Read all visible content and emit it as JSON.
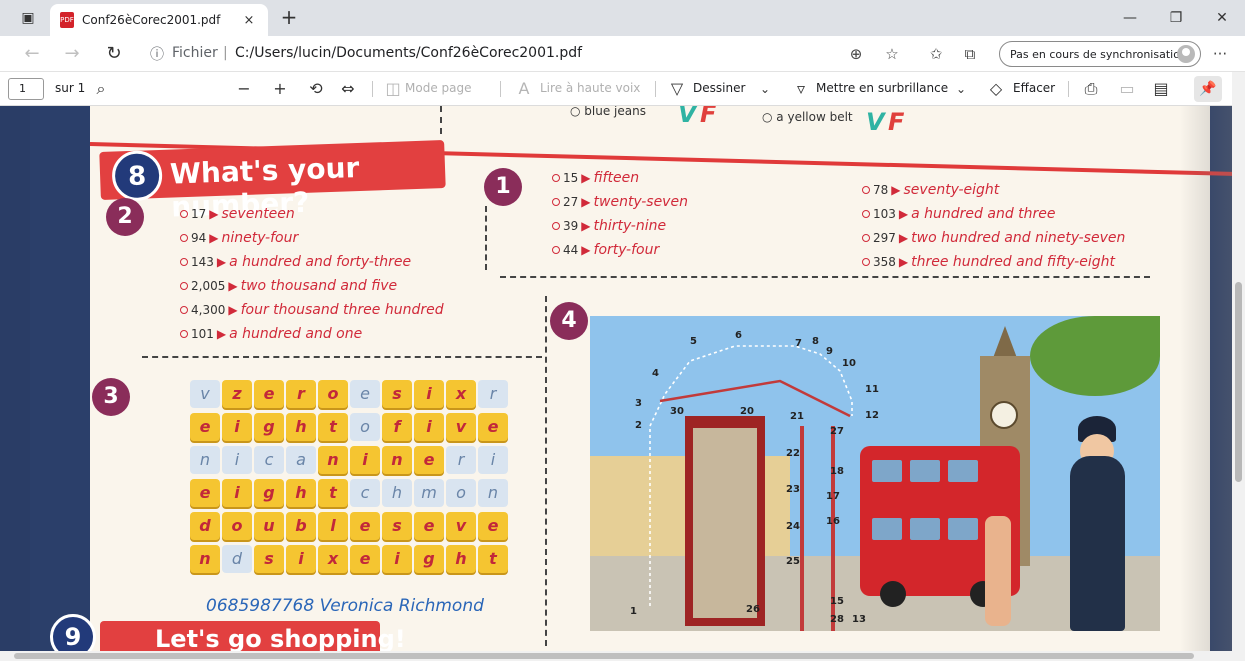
{
  "browser": {
    "tab_title": "Conf26èCorec2001.pdf",
    "tab_close": "×",
    "new_tab": "+",
    "address_scheme": "Fichier",
    "address_url": "C:/Users/lucin/Documents/Conf26èCorec2001.pdf",
    "sync_label": "Pas en cours de synchronisation",
    "more_label": "···"
  },
  "pdf_toolbar": {
    "page_current": "1",
    "page_total": "sur 1",
    "mode_page": "Mode page",
    "read_aloud": "Lire à haute voix",
    "draw": "Dessiner",
    "highlight": "Mettre en surbrillance",
    "erase": "Effacer"
  },
  "document": {
    "top_fragment": {
      "item_left": "blue jeans",
      "item_right": "a yellow belt",
      "v_label": "V",
      "f_label": "F"
    },
    "section8": {
      "number": "8",
      "title": "What's your number?"
    },
    "exercise1": {
      "badge": "1",
      "left": [
        {
          "n": "15",
          "w": "fifteen"
        },
        {
          "n": "27",
          "w": "twenty-seven"
        },
        {
          "n": "39",
          "w": "thirty-nine"
        },
        {
          "n": "44",
          "w": "forty-four"
        }
      ],
      "right": [
        {
          "n": "78",
          "w": "seventy-eight"
        },
        {
          "n": "103",
          "w": "a hundred and three"
        },
        {
          "n": "297",
          "w": "two hundred and ninety-seven"
        },
        {
          "n": "358",
          "w": "three hundred and fifty-eight"
        }
      ]
    },
    "exercise2": {
      "badge": "2",
      "items": [
        {
          "n": "17",
          "w": "seventeen"
        },
        {
          "n": "94",
          "w": "ninety-four"
        },
        {
          "n": "143",
          "w": "a hundred and forty-three"
        },
        {
          "n": "2,005",
          "w": "two thousand and five"
        },
        {
          "n": "4,300",
          "w": "four thousand three hundred"
        },
        {
          "n": "101",
          "w": "a hundred and one"
        }
      ]
    },
    "exercise3": {
      "badge": "3",
      "rows": [
        [
          [
            "v",
            "b"
          ],
          [
            "z",
            "y"
          ],
          [
            "e",
            "y"
          ],
          [
            "r",
            "y"
          ],
          [
            "o",
            "y"
          ],
          [
            "e",
            "b"
          ],
          [
            "s",
            "y"
          ],
          [
            "i",
            "y"
          ],
          [
            "x",
            "y"
          ],
          [
            "r",
            "b"
          ]
        ],
        [
          [
            "e",
            "y"
          ],
          [
            "i",
            "y"
          ],
          [
            "g",
            "y"
          ],
          [
            "h",
            "y"
          ],
          [
            "t",
            "y"
          ],
          [
            "o",
            "b"
          ],
          [
            "f",
            "y"
          ],
          [
            "i",
            "y"
          ],
          [
            "v",
            "y"
          ],
          [
            "e",
            "y"
          ]
        ],
        [
          [
            "n",
            "b"
          ],
          [
            "i",
            "b"
          ],
          [
            "c",
            "b"
          ],
          [
            "a",
            "b"
          ],
          [
            "n",
            "y"
          ],
          [
            "i",
            "y"
          ],
          [
            "n",
            "y"
          ],
          [
            "e",
            "y"
          ],
          [
            "r",
            "b"
          ],
          [
            "i",
            "b"
          ]
        ],
        [
          [
            "e",
            "y"
          ],
          [
            "i",
            "y"
          ],
          [
            "g",
            "y"
          ],
          [
            "h",
            "y"
          ],
          [
            "t",
            "y"
          ],
          [
            "c",
            "b"
          ],
          [
            "h",
            "b"
          ],
          [
            "m",
            "b"
          ],
          [
            "o",
            "b"
          ],
          [
            "n",
            "b"
          ]
        ],
        [
          [
            "d",
            "y"
          ],
          [
            "o",
            "y"
          ],
          [
            "u",
            "y"
          ],
          [
            "b",
            "y"
          ],
          [
            "l",
            "y"
          ],
          [
            "e",
            "y"
          ],
          [
            "s",
            "y"
          ],
          [
            "e",
            "y"
          ],
          [
            "v",
            "y"
          ],
          [
            "e",
            "y"
          ]
        ],
        [
          [
            "n",
            "y"
          ],
          [
            "d",
            "b"
          ],
          [
            "s",
            "y"
          ],
          [
            "i",
            "y"
          ],
          [
            "x",
            "y"
          ],
          [
            "e",
            "y"
          ],
          [
            "i",
            "y"
          ],
          [
            "g",
            "y"
          ],
          [
            "h",
            "y"
          ],
          [
            "t",
            "y"
          ]
        ]
      ],
      "phone": "0685987768 Veronica Richmond"
    },
    "exercise4": {
      "badge": "4",
      "dots": [
        "1",
        "2",
        "3",
        "4",
        "5",
        "6",
        "7",
        "8",
        "9",
        "10",
        "11",
        "12",
        "13",
        "15",
        "16",
        "17",
        "18",
        "20",
        "21",
        "22",
        "23",
        "24",
        "25",
        "26",
        "27",
        "28",
        "30"
      ]
    },
    "section9": {
      "number": "9",
      "title": "Let's go shopping!"
    }
  }
}
